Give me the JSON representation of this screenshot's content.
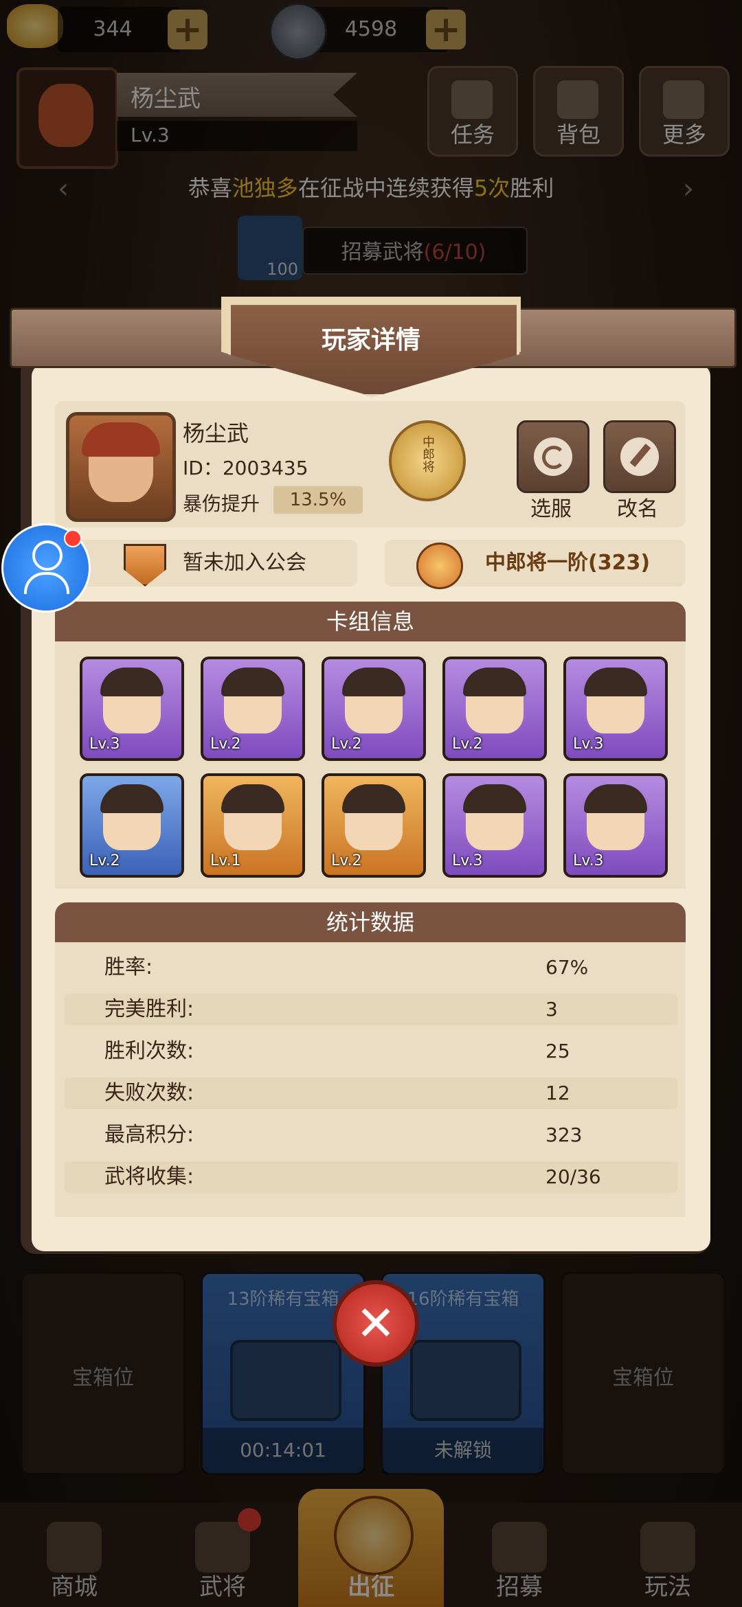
{
  "top": {
    "gold_amount": "344",
    "coin_amount": "4598"
  },
  "header": {
    "player_name": "杨尘武",
    "player_level": "Lv.3",
    "buttons": [
      {
        "label": "任务",
        "icon": "task-icon"
      },
      {
        "label": "背包",
        "icon": "bag-icon"
      },
      {
        "label": "更多",
        "icon": "menu-icon"
      }
    ]
  },
  "ticker": {
    "prefix": "恭喜",
    "name": "池独多",
    "middle": "在征战中连续获得",
    "count": "5次",
    "suffix": "胜利"
  },
  "recruit": {
    "cost": "100",
    "label": "招募武将",
    "progress": "(6/10)"
  },
  "modal": {
    "title": "玩家详情",
    "profile": {
      "name": "杨尘武",
      "id": "ID：2003435",
      "crit_label": "暴伤提升",
      "crit_value": "13.5%",
      "rank_badge_text": "中郎将"
    },
    "actions": [
      {
        "label": "选服",
        "icon": "refresh-icon"
      },
      {
        "label": "改名",
        "icon": "edit-icon"
      }
    ],
    "guild_text": "暂未加入公会",
    "rank_text": "中郎将一阶(323)",
    "deck_title": "卡组信息",
    "deck": [
      {
        "level": "Lv.3",
        "rarity": "purple"
      },
      {
        "level": "Lv.2",
        "rarity": "purple"
      },
      {
        "level": "Lv.2",
        "rarity": "purple"
      },
      {
        "level": "Lv.2",
        "rarity": "purple"
      },
      {
        "level": "Lv.3",
        "rarity": "purple"
      },
      {
        "level": "Lv.2",
        "rarity": "blue"
      },
      {
        "level": "Lv.1",
        "rarity": "orange"
      },
      {
        "level": "Lv.2",
        "rarity": "orange"
      },
      {
        "level": "Lv.3",
        "rarity": "purple"
      },
      {
        "level": "Lv.3",
        "rarity": "purple"
      }
    ],
    "stats_title": "统计数据",
    "stats": [
      {
        "label": "胜率:",
        "value": "67%"
      },
      {
        "label": "完美胜利:",
        "value": "3"
      },
      {
        "label": "胜利次数:",
        "value": "25"
      },
      {
        "label": "失败次数:",
        "value": "12"
      },
      {
        "label": "最高积分:",
        "value": "323"
      },
      {
        "label": "武将收集:",
        "value": "20/36"
      }
    ]
  },
  "chests": {
    "slot_left": "宝箱位",
    "slot_right": "宝箱位",
    "chest1_title": "13阶稀有宝箱",
    "chest1_timer": "00:14:01",
    "chest2_title": "16阶稀有宝箱",
    "chest2_status": "未解锁"
  },
  "nav": {
    "items": [
      {
        "label": "商城",
        "icon": "shop-icon"
      },
      {
        "label": "武将",
        "icon": "general-icon"
      },
      {
        "label": "出征",
        "icon": "battle-icon"
      },
      {
        "label": "招募",
        "icon": "recruit-icon"
      },
      {
        "label": "玩法",
        "icon": "play-icon"
      }
    ]
  },
  "colors": {
    "highlight": "#ffcc33",
    "panel": "#f3e8d2",
    "section_header": "#7a5440",
    "close": "#d8382f"
  }
}
